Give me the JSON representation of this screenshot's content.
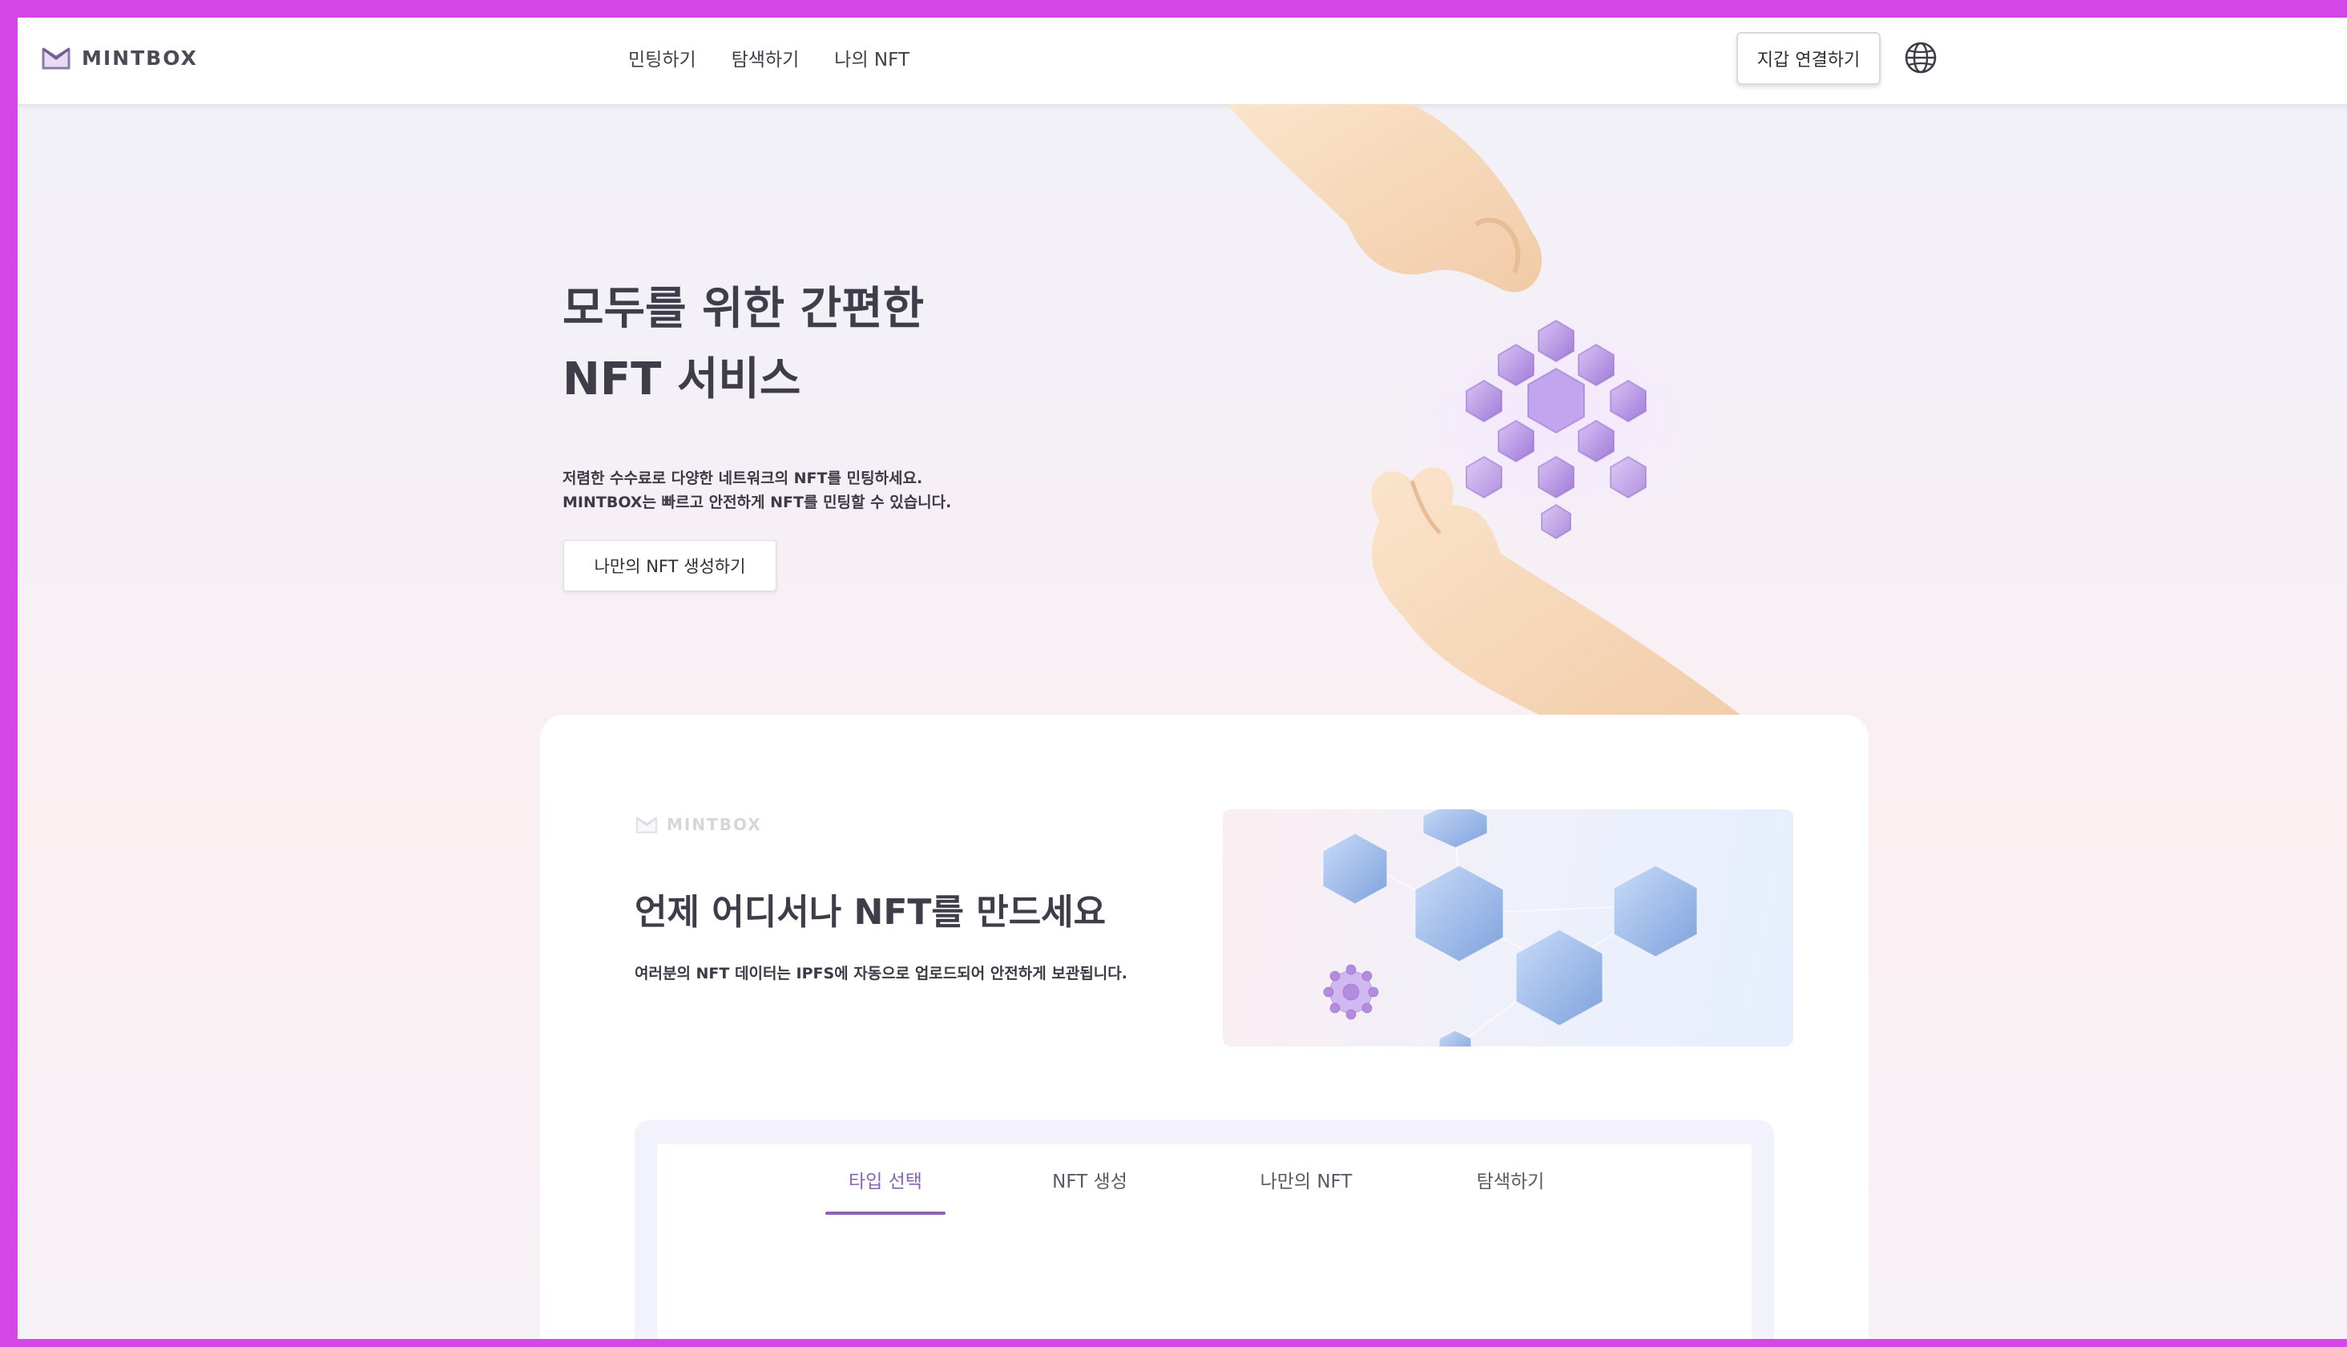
{
  "header": {
    "logo_text": "MINTBOX",
    "nav": [
      "민팅하기",
      "탐색하기",
      "나의 NFT"
    ],
    "wallet_button": "지갑 연결하기"
  },
  "hero": {
    "title_line1": "모두를 위한 간편한",
    "title_line2": "NFT 서비스",
    "desc_line1": "저렴한 수수료로 다양한 네트워크의 NFT를 민팅하세요.",
    "desc_line2": "MINTBOX는 빠르고 안전하게 NFT를 민팅할 수 있습니다.",
    "cta": "나만의 NFT 생성하기"
  },
  "section": {
    "logo_text": "MINTBOX",
    "title": "언제 어디서나 NFT를 만드세요",
    "desc": "여러분의 NFT 데이터는 IPFS에 자동으로 업로드되어 안전하게 보관됩니다."
  },
  "tabs": [
    {
      "label": "타입 선택",
      "active": true
    },
    {
      "label": "NFT 생성",
      "active": false
    },
    {
      "label": "나만의 NFT",
      "active": false
    },
    {
      "label": "탐색하기",
      "active": false
    }
  ],
  "colors": {
    "accent": "#8a63b4",
    "frame": "#d447e6",
    "text": "#3e3d4a"
  },
  "icons": {
    "logo": "mintbox-logo-icon",
    "globe": "globe-icon"
  }
}
